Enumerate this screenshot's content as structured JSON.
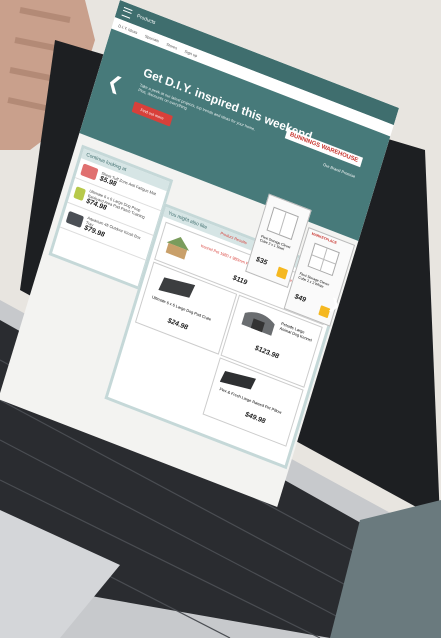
{
  "site": {
    "menu_label": "Products",
    "nav": [
      "D.I.Y. Ideas",
      "Specials",
      "Stores",
      "Sign up"
    ],
    "logo": "BUNNINGS WAREHOUSE",
    "logo_tagline": "Our Brand Promise"
  },
  "hero": {
    "title": "Get D.I.Y. inspired this weekend",
    "subtitle": "Take a peek at our latest projects, top trends and ideas for your home. Plus, discounts on everything",
    "cta": "Find out more"
  },
  "continue_panel": {
    "title": "Continue looking at",
    "items": [
      {
        "name": "Sheet Tuff Zone Anti Fatigue Mat",
        "price": "$5.98"
      },
      {
        "name": "Ultimate 6 x 6 Large Dog Poop Backyard Area Pad Patch Training",
        "price": "$74.98"
      },
      {
        "name": "Aquarium 4ft Outdoor Kiosk Box Tray",
        "price": "$79.98"
      }
    ]
  },
  "you_might_like": {
    "title": "You might also like",
    "link": "Product Results",
    "items": [
      {
        "name": "Kennel Pet 1980 x 980mm Pet Dog Wood Tray Outside",
        "price": "$119"
      },
      {
        "name": "Ultimate 6 x 6 Large Dog Pad Crate",
        "price": "$24.98"
      },
      {
        "name": "Petsafe Large Animal Dog Kennel",
        "price": "$123.98"
      },
      {
        "name": "Flex & Fresh Large Raised Pet Pillow",
        "price": "$49.98"
      }
    ]
  },
  "storage": [
    {
      "name": "Flexi Storage Clever Cube 2 x 1 Steel",
      "price": "$35"
    },
    {
      "name": "Flexi Storage Clever Cube 2 x 2 White",
      "price": "$49"
    }
  ],
  "marketplace_badge": "MARKETPLACE",
  "colors": {
    "teal": "#477a7a",
    "red": "#d8403a",
    "yellow": "#f5b820"
  }
}
